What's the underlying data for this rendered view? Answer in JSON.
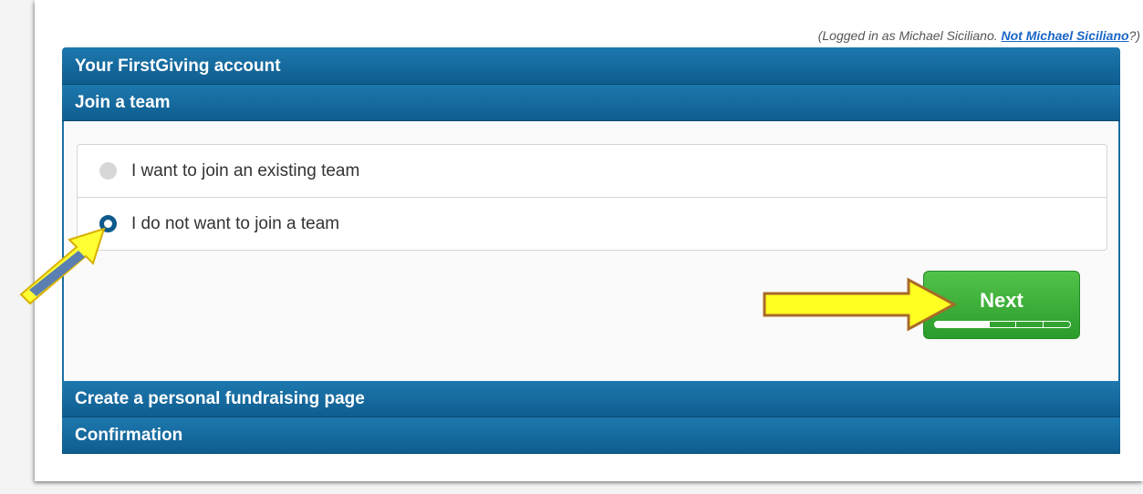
{
  "login": {
    "prefix": "(Logged in as Michael Siciliano. ",
    "link": "Not Michael Siciliano",
    "suffix": "?)"
  },
  "sections": {
    "account": "Your FirstGiving account",
    "join_team": "Join a team",
    "create_page": "Create a personal fundraising page",
    "confirmation": "Confirmation"
  },
  "options": [
    {
      "label": "I want to join an existing team",
      "selected": false
    },
    {
      "label": "I do not want to join a team",
      "selected": true
    }
  ],
  "next_button": {
    "label": "Next",
    "progress_step": 2,
    "progress_total": 5
  },
  "colors": {
    "header_blue": "#0f5d8f",
    "button_green": "#3cb03a",
    "arrow_yellow": "#ffff33"
  }
}
